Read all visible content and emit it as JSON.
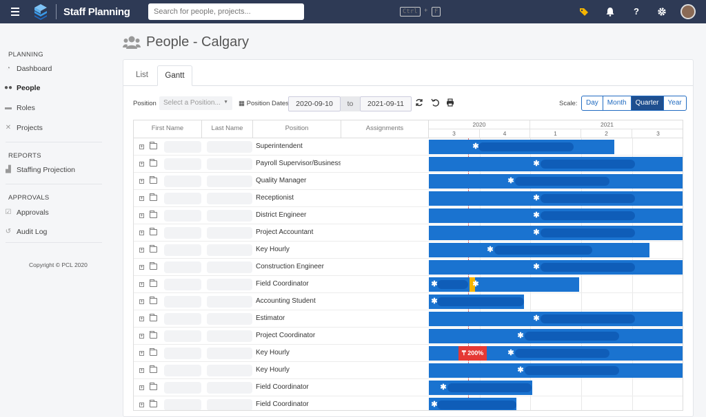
{
  "app": {
    "name": "Staff Planning"
  },
  "search": {
    "placeholder": "Search for people, projects...",
    "key1": "Ctrl",
    "plus": "+",
    "key2": "F"
  },
  "sidebar": {
    "sections": [
      {
        "header": "PLANNING",
        "items": [
          {
            "label": "Dashboard",
            "icon": "dashboard-icon",
            "active": false
          },
          {
            "label": "People",
            "icon": "users-icon",
            "active": true
          },
          {
            "label": "Roles",
            "icon": "roles-icon",
            "active": false
          },
          {
            "label": "Projects",
            "icon": "tools-icon",
            "active": false
          }
        ]
      },
      {
        "header": "REPORTS",
        "items": [
          {
            "label": "Staffing Projection",
            "icon": "chart-icon",
            "active": false
          }
        ]
      },
      {
        "header": "APPROVALS",
        "items": [
          {
            "label": "Approvals",
            "icon": "check-icon",
            "active": false
          },
          {
            "label": "Audit Log",
            "icon": "history-icon",
            "active": false
          }
        ]
      }
    ],
    "copyright": "Copyright © PCL 2020"
  },
  "page": {
    "title": "People - Calgary"
  },
  "tabs": [
    {
      "label": "List",
      "active": false
    },
    {
      "label": "Gantt",
      "active": true
    }
  ],
  "filters": {
    "position_label": "Position",
    "position_placeholder": "Select a Position...",
    "dates_label": "Position Dates",
    "start_date": "2020-09-10",
    "to_label": "to",
    "end_date": "2021-09-11",
    "scale_label": "Scale:",
    "scale_options": [
      "Day",
      "Month",
      "Quarter",
      "Year"
    ],
    "scale_selected": "Quarter"
  },
  "grid": {
    "columns": [
      "First Name",
      "Last Name",
      "Position",
      "Assignments"
    ],
    "years": [
      "2020",
      "2021"
    ],
    "quarters": [
      "3",
      "4",
      "1",
      "2",
      "3"
    ],
    "rows": [
      {
        "position": "Superintendent"
      },
      {
        "position": "Payroll Supervisor/Business S"
      },
      {
        "position": "Quality Manager"
      },
      {
        "position": "Receptionist"
      },
      {
        "position": "District Engineer"
      },
      {
        "position": "Project Accountant"
      },
      {
        "position": "Key Hourly"
      },
      {
        "position": "Construction Engineer"
      },
      {
        "position": "Field Coordinator"
      },
      {
        "position": "Accounting Student"
      },
      {
        "position": "Estimator"
      },
      {
        "position": "Project Coordinator"
      },
      {
        "position": "Key Hourly",
        "overallocation": "200%"
      },
      {
        "position": "Key Hourly"
      },
      {
        "position": "Field Coordinator"
      },
      {
        "position": "Field Coordinator"
      }
    ]
  },
  "colors": {
    "bar": "#1a73d0",
    "bar_inner": "#0f5db8",
    "overallocation": "#e53935",
    "warning": "#f4b400",
    "topbar": "#2e3a55",
    "scale_active": "#1f4f8f"
  }
}
